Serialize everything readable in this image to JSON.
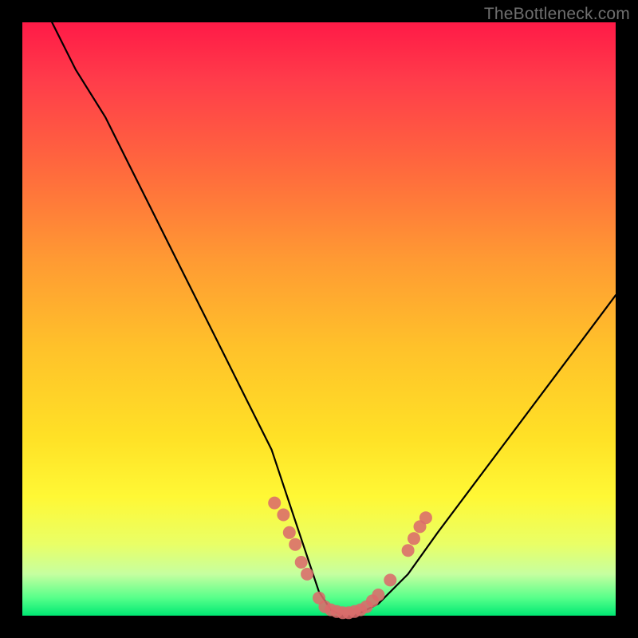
{
  "watermark": "TheBottleneck.com",
  "gradient_colors": {
    "top": "#ff1a47",
    "mid": "#ffe126",
    "bottom": "#00e873"
  },
  "marker_color": "#db6b6b",
  "curve_color": "#000000",
  "chart_data": {
    "type": "line",
    "title": "",
    "xlabel": "",
    "ylabel": "",
    "xlim": [
      0,
      100
    ],
    "ylim": [
      0,
      100
    ],
    "grid": false,
    "series": [
      {
        "name": "bottleneck-curve",
        "x": [
          5,
          9,
          14,
          18,
          22,
          26,
          30,
          34,
          38,
          42,
          46,
          48,
          50,
          52,
          54,
          56,
          58,
          60,
          65,
          70,
          76,
          82,
          88,
          94,
          100
        ],
        "values": [
          100,
          92,
          84,
          76,
          68,
          60,
          52,
          44,
          36,
          28,
          16,
          10,
          4,
          1,
          0,
          0,
          1,
          2,
          7,
          14,
          22,
          30,
          38,
          46,
          54
        ]
      }
    ],
    "markers": [
      {
        "x": 42.5,
        "y": 19
      },
      {
        "x": 44,
        "y": 17
      },
      {
        "x": 45,
        "y": 14
      },
      {
        "x": 46,
        "y": 12
      },
      {
        "x": 47,
        "y": 9
      },
      {
        "x": 48,
        "y": 7
      },
      {
        "x": 50,
        "y": 3
      },
      {
        "x": 51,
        "y": 1.5
      },
      {
        "x": 52,
        "y": 1
      },
      {
        "x": 53,
        "y": 0.7
      },
      {
        "x": 54,
        "y": 0.5
      },
      {
        "x": 55,
        "y": 0.5
      },
      {
        "x": 56,
        "y": 0.7
      },
      {
        "x": 57,
        "y": 1
      },
      {
        "x": 58,
        "y": 1.5
      },
      {
        "x": 59,
        "y": 2.5
      },
      {
        "x": 60,
        "y": 3.5
      },
      {
        "x": 62,
        "y": 6
      },
      {
        "x": 65,
        "y": 11
      },
      {
        "x": 66,
        "y": 13
      },
      {
        "x": 67,
        "y": 15
      },
      {
        "x": 68,
        "y": 16.5
      }
    ]
  }
}
